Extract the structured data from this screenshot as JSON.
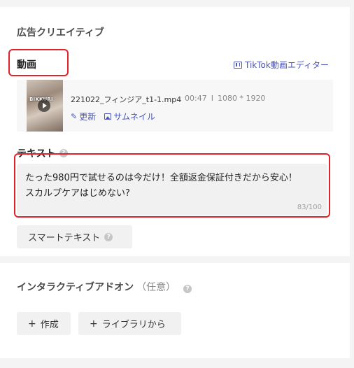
{
  "ad_creative": {
    "title": "広告クリエイティブ",
    "video": {
      "label": "動画",
      "editor_link": "TikTok動画エディター",
      "thumbnail_text": "BIKKURI",
      "filename": "221022_フィンジア_t1-1.mp4",
      "duration": "00:47",
      "separator": "I",
      "resolution": "1080 * 1920",
      "update_label": "更新",
      "thumbnail_label": "サムネイル"
    },
    "text": {
      "label": "テキスト",
      "value": "たった980円で試せるのは今だけ！全額返金保証付きだから安心！\nスカルプケアはじめない?",
      "counter": "83/100"
    },
    "smart_text_button": "スマートテキスト"
  },
  "interactive_addon": {
    "title": "インタラクティブアドオン",
    "optional": "（任意）",
    "create_button": "作成",
    "library_button": "ライブラリから"
  },
  "colors": {
    "accent_link": "#4a55b5",
    "highlight_red": "#e0242b",
    "background": "#f4f4f5"
  },
  "icons": [
    "film-icon",
    "play-icon",
    "pencil-icon",
    "image-icon",
    "help-icon",
    "plus-icon"
  ]
}
